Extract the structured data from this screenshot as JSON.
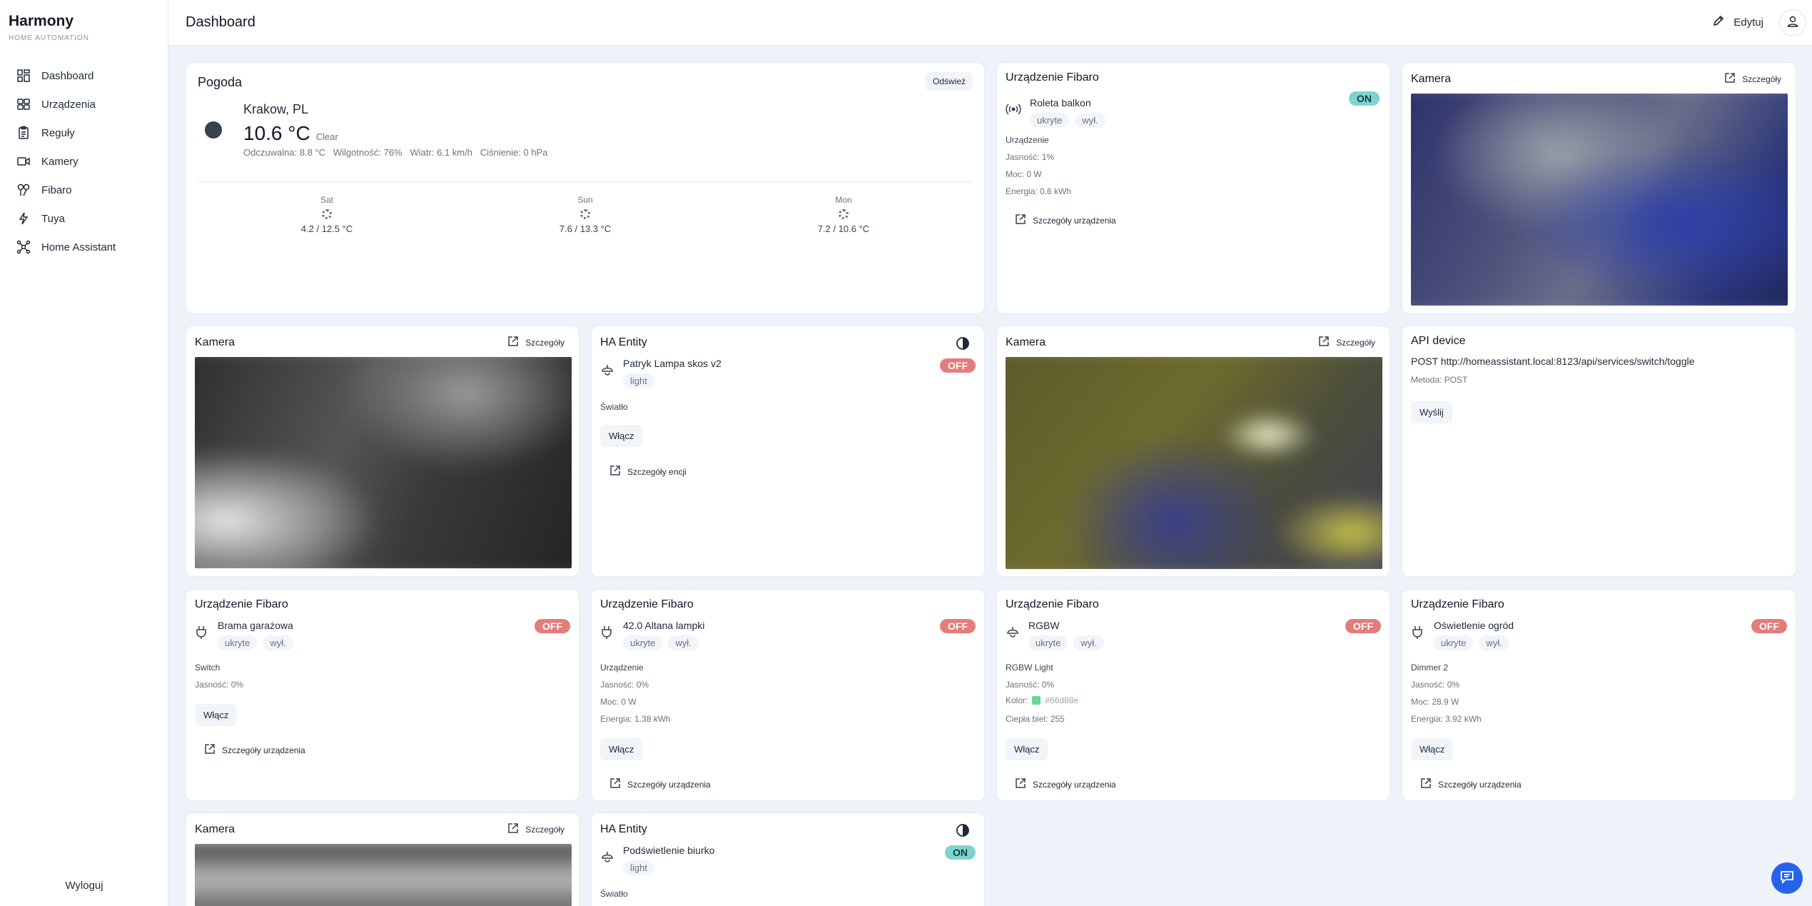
{
  "brand": {
    "name": "Harmony",
    "subtitle": "HOME AUTOMATION"
  },
  "nav": [
    {
      "label": "Dashboard",
      "icon": "grid-icon"
    },
    {
      "label": "Urządzenia",
      "icon": "devices-icon"
    },
    {
      "label": "Reguły",
      "icon": "rules-icon"
    },
    {
      "label": "Kamery",
      "icon": "camera-icon"
    },
    {
      "label": "Fibaro",
      "icon": "fibaro-icon"
    },
    {
      "label": "Tuya",
      "icon": "bolt-icon"
    },
    {
      "label": "Home Assistant",
      "icon": "network-icon"
    }
  ],
  "logout": "Wyloguj",
  "header": {
    "title": "Dashboard",
    "edit": "Edytuj"
  },
  "weather": {
    "title": "Pogoda",
    "refresh": "Odśwież",
    "location": "Krakow, PL",
    "temp": "10.6 °C",
    "condition": "Clear",
    "details": "Odczuwalna: 8.8 °C   Wilgotność: 76%   Wiatr: 6.1 km/h   Ciśnienie: 0 hPa",
    "forecast": [
      {
        "day": "Sat",
        "range": "4.2 / 12.5 °C"
      },
      {
        "day": "Sun",
        "range": "7.6 / 13.3 °C"
      },
      {
        "day": "Mon",
        "range": "7.2 / 10.6 °C"
      }
    ]
  },
  "common": {
    "details_link": "Szczegóły",
    "device_details": "Szczegóły urządzenia",
    "entity_details": "Szczegóły encji",
    "turn_on": "Włącz",
    "hidden": "ukryte",
    "off_tag": "wył.",
    "on": "ON",
    "off": "OFF",
    "fibaro_title": "Urządzenie Fibaro",
    "camera_title": "Kamera",
    "ha_title": "HA Entity",
    "light_tag": "light",
    "light_type": "Światło"
  },
  "fibaro_roleta": {
    "name": "Roleta balkon",
    "type": "Urządzenie",
    "brightness": "Jasność: 1%",
    "power": "Moc: 0 W",
    "energy": "Energia: 0.6 kWh"
  },
  "ha_lampa": {
    "name": "Patryk Lampa skos v2"
  },
  "api_device": {
    "title": "API device",
    "url": "POST http://homeassistant.local:8123/api/services/switch/toggle",
    "method": "Metoda: POST",
    "send": "Wyślij"
  },
  "fibaro_brama": {
    "name": "Brama garażowa",
    "type": "Switch",
    "brightness": "Jasność: 0%"
  },
  "fibaro_altana": {
    "name": "42.0 Altana lampki",
    "type": "Urządzenie",
    "brightness": "Jasność: 0%",
    "power": "Moc: 0 W",
    "energy": "Energia: 1.38 kWh"
  },
  "fibaro_rgbw": {
    "name": "RGBW",
    "type": "RGBW Light",
    "brightness": "Jasność: 0%",
    "color_label": "Kolor:",
    "color_value": "#66d88e",
    "warm": "Ciepła biel: 255"
  },
  "fibaro_ogrod": {
    "name": "Oświetlenie ogród",
    "type": "Dimmer 2",
    "brightness": "Jasność: 0%",
    "power": "Moc: 28.9 W",
    "energy": "Energia: 3.92 kWh"
  },
  "ha_biurko": {
    "name": "Podświetlenie biurko"
  }
}
